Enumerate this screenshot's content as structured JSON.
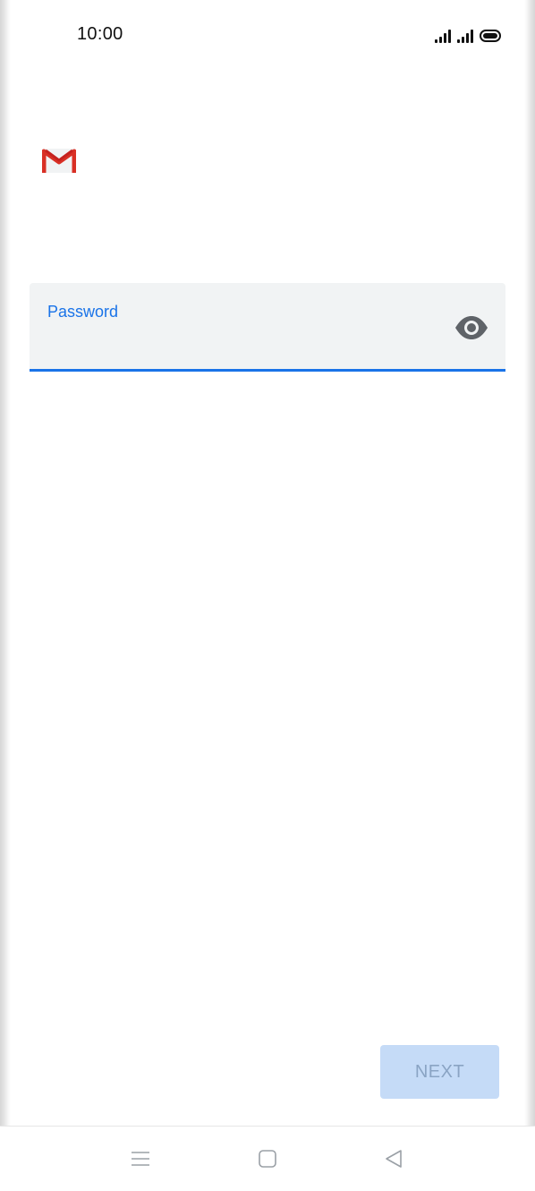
{
  "status_bar": {
    "time": "10:00",
    "icons": [
      "signal-icon",
      "signal-icon",
      "battery-icon"
    ]
  },
  "app": {
    "logo": "gmail-logo",
    "brand_colors": {
      "red": "#d93025",
      "light": "#f1f3f4"
    }
  },
  "password_field": {
    "label": "Password",
    "value": "",
    "visibility_icon": "eye-icon"
  },
  "actions": {
    "next_label": "NEXT"
  },
  "nav_bar": {
    "icons": [
      "menu-icon",
      "home-icon",
      "back-icon"
    ]
  },
  "colors": {
    "accent": "#1a73e8",
    "field_background": "#f1f3f4",
    "next_disabled_bg": "#c5dbf7",
    "next_disabled_text": "#8aa4c4"
  }
}
